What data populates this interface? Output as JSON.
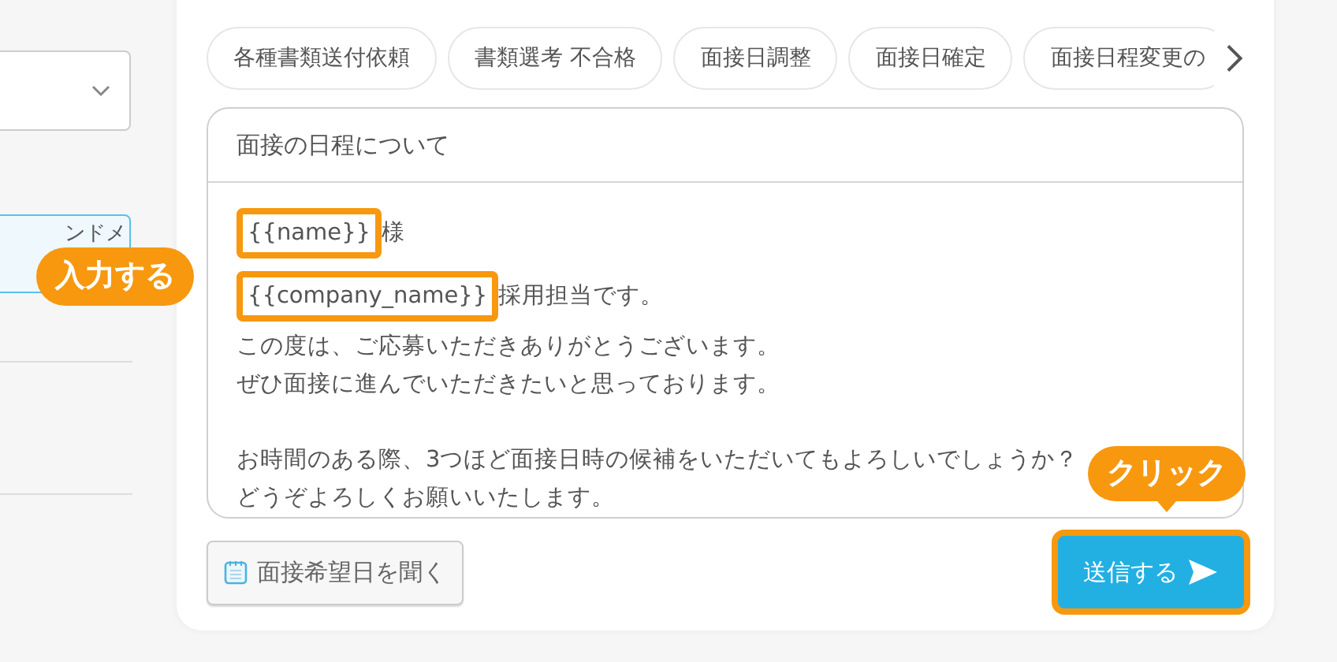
{
  "left_panel": {
    "field_text": "ンドメ"
  },
  "template_chips": [
    {
      "label": "各種書類送付依頼"
    },
    {
      "label": "書類選考 不合格"
    },
    {
      "label": "面接日調整"
    },
    {
      "label": "面接日確定"
    },
    {
      "label": "面接日程変更の"
    }
  ],
  "message": {
    "subject": "面接の日程について",
    "paragraphs": [
      [
        [
          {
            "text": "{{name}}",
            "highlighted": true
          },
          {
            "text": "様",
            "highlighted": false
          }
        ],
        [
          {
            "text": "{{company_name}}",
            "highlighted": true
          },
          {
            "text": "採用担当です。",
            "highlighted": false
          }
        ],
        [
          {
            "text": "この度は、ご応募いただきありがとうございます。",
            "highlighted": false
          }
        ],
        [
          {
            "text": "ぜひ面接に進んでいただきたいと思っております。",
            "highlighted": false
          }
        ]
      ],
      [
        [
          {
            "text": "お時間のある際、3つほど面接日時の候補をいただいてもよろしいでしょうか？",
            "highlighted": false
          }
        ],
        [
          {
            "text": "どうぞよろしくお願いいたします。",
            "highlighted": false
          }
        ]
      ]
    ]
  },
  "ask_button": {
    "label": "面接希望日を聞く"
  },
  "send_button": {
    "label": "送信する",
    "highlighted": true
  },
  "callouts": [
    {
      "kind": "badge",
      "text": "入力する"
    },
    {
      "kind": "bubble",
      "text": "クリック"
    }
  ]
}
